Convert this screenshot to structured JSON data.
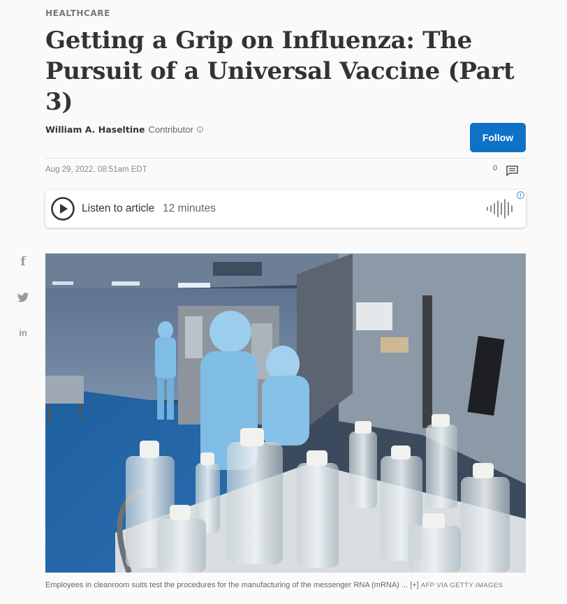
{
  "article": {
    "section": "HEALTHCARE",
    "headline": "Getting a Grip on Influenza: The Pursuit of a Universal Vaccine (Part 3)",
    "author": "William A. Haseltine",
    "role": "Contributor",
    "follow_label": "Follow",
    "dateline": "Aug 29, 2022, 08:51am EDT",
    "comment_count": "0"
  },
  "audio": {
    "listen_label": "Listen to article",
    "duration": "12 minutes"
  },
  "share": {
    "facebook": "f",
    "linkedin": "in"
  },
  "image": {
    "caption": "Employees in cleanroom suits test the procedures for the manufacturing of the messenger RNA (mRNA) ...",
    "expand_label": "[+]",
    "credit": "AFP VIA GETTY IMAGES"
  },
  "colors": {
    "accent": "#0e72c9",
    "headline": "#333333"
  }
}
